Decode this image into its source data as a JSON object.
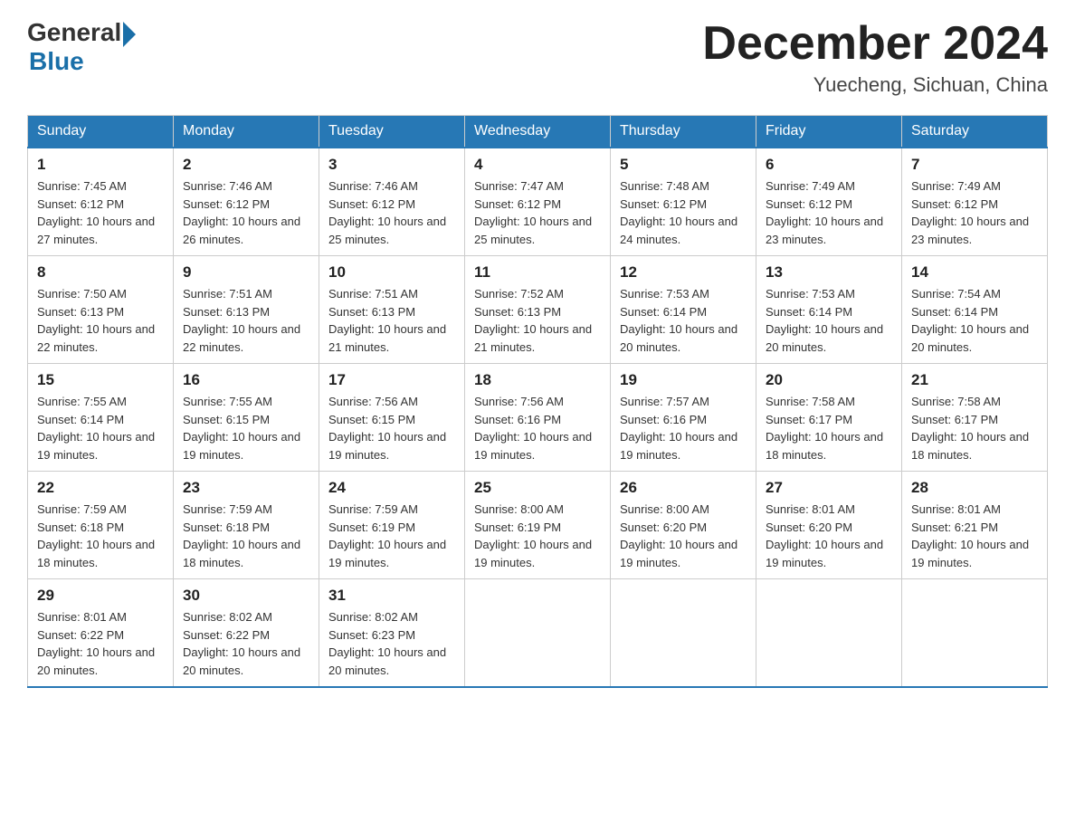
{
  "header": {
    "logo": {
      "general": "General",
      "blue": "Blue"
    },
    "title": "December 2024",
    "subtitle": "Yuecheng, Sichuan, China"
  },
  "days_of_week": [
    "Sunday",
    "Monday",
    "Tuesday",
    "Wednesday",
    "Thursday",
    "Friday",
    "Saturday"
  ],
  "weeks": [
    [
      {
        "day": "1",
        "sunrise": "7:45 AM",
        "sunset": "6:12 PM",
        "daylight": "10 hours and 27 minutes."
      },
      {
        "day": "2",
        "sunrise": "7:46 AM",
        "sunset": "6:12 PM",
        "daylight": "10 hours and 26 minutes."
      },
      {
        "day": "3",
        "sunrise": "7:46 AM",
        "sunset": "6:12 PM",
        "daylight": "10 hours and 25 minutes."
      },
      {
        "day": "4",
        "sunrise": "7:47 AM",
        "sunset": "6:12 PM",
        "daylight": "10 hours and 25 minutes."
      },
      {
        "day": "5",
        "sunrise": "7:48 AM",
        "sunset": "6:12 PM",
        "daylight": "10 hours and 24 minutes."
      },
      {
        "day": "6",
        "sunrise": "7:49 AM",
        "sunset": "6:12 PM",
        "daylight": "10 hours and 23 minutes."
      },
      {
        "day": "7",
        "sunrise": "7:49 AM",
        "sunset": "6:12 PM",
        "daylight": "10 hours and 23 minutes."
      }
    ],
    [
      {
        "day": "8",
        "sunrise": "7:50 AM",
        "sunset": "6:13 PM",
        "daylight": "10 hours and 22 minutes."
      },
      {
        "day": "9",
        "sunrise": "7:51 AM",
        "sunset": "6:13 PM",
        "daylight": "10 hours and 22 minutes."
      },
      {
        "day": "10",
        "sunrise": "7:51 AM",
        "sunset": "6:13 PM",
        "daylight": "10 hours and 21 minutes."
      },
      {
        "day": "11",
        "sunrise": "7:52 AM",
        "sunset": "6:13 PM",
        "daylight": "10 hours and 21 minutes."
      },
      {
        "day": "12",
        "sunrise": "7:53 AM",
        "sunset": "6:14 PM",
        "daylight": "10 hours and 20 minutes."
      },
      {
        "day": "13",
        "sunrise": "7:53 AM",
        "sunset": "6:14 PM",
        "daylight": "10 hours and 20 minutes."
      },
      {
        "day": "14",
        "sunrise": "7:54 AM",
        "sunset": "6:14 PM",
        "daylight": "10 hours and 20 minutes."
      }
    ],
    [
      {
        "day": "15",
        "sunrise": "7:55 AM",
        "sunset": "6:14 PM",
        "daylight": "10 hours and 19 minutes."
      },
      {
        "day": "16",
        "sunrise": "7:55 AM",
        "sunset": "6:15 PM",
        "daylight": "10 hours and 19 minutes."
      },
      {
        "day": "17",
        "sunrise": "7:56 AM",
        "sunset": "6:15 PM",
        "daylight": "10 hours and 19 minutes."
      },
      {
        "day": "18",
        "sunrise": "7:56 AM",
        "sunset": "6:16 PM",
        "daylight": "10 hours and 19 minutes."
      },
      {
        "day": "19",
        "sunrise": "7:57 AM",
        "sunset": "6:16 PM",
        "daylight": "10 hours and 19 minutes."
      },
      {
        "day": "20",
        "sunrise": "7:58 AM",
        "sunset": "6:17 PM",
        "daylight": "10 hours and 18 minutes."
      },
      {
        "day": "21",
        "sunrise": "7:58 AM",
        "sunset": "6:17 PM",
        "daylight": "10 hours and 18 minutes."
      }
    ],
    [
      {
        "day": "22",
        "sunrise": "7:59 AM",
        "sunset": "6:18 PM",
        "daylight": "10 hours and 18 minutes."
      },
      {
        "day": "23",
        "sunrise": "7:59 AM",
        "sunset": "6:18 PM",
        "daylight": "10 hours and 18 minutes."
      },
      {
        "day": "24",
        "sunrise": "7:59 AM",
        "sunset": "6:19 PM",
        "daylight": "10 hours and 19 minutes."
      },
      {
        "day": "25",
        "sunrise": "8:00 AM",
        "sunset": "6:19 PM",
        "daylight": "10 hours and 19 minutes."
      },
      {
        "day": "26",
        "sunrise": "8:00 AM",
        "sunset": "6:20 PM",
        "daylight": "10 hours and 19 minutes."
      },
      {
        "day": "27",
        "sunrise": "8:01 AM",
        "sunset": "6:20 PM",
        "daylight": "10 hours and 19 minutes."
      },
      {
        "day": "28",
        "sunrise": "8:01 AM",
        "sunset": "6:21 PM",
        "daylight": "10 hours and 19 minutes."
      }
    ],
    [
      {
        "day": "29",
        "sunrise": "8:01 AM",
        "sunset": "6:22 PM",
        "daylight": "10 hours and 20 minutes."
      },
      {
        "day": "30",
        "sunrise": "8:02 AM",
        "sunset": "6:22 PM",
        "daylight": "10 hours and 20 minutes."
      },
      {
        "day": "31",
        "sunrise": "8:02 AM",
        "sunset": "6:23 PM",
        "daylight": "10 hours and 20 minutes."
      },
      null,
      null,
      null,
      null
    ]
  ],
  "labels": {
    "sunrise": "Sunrise: ",
    "sunset": "Sunset: ",
    "daylight": "Daylight: "
  }
}
